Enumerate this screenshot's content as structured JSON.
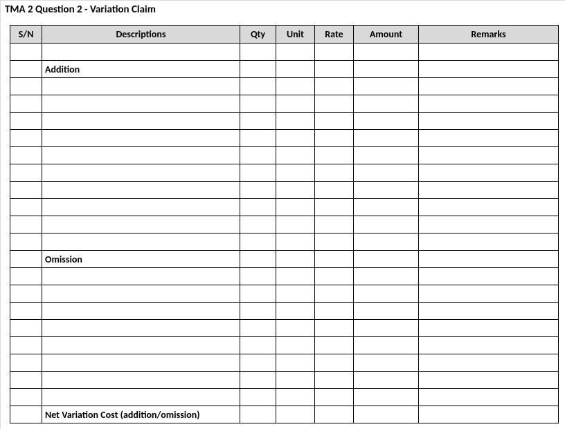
{
  "title": "TMA 2 Question 2 - Variation Claim",
  "headers": {
    "sn": "S/N",
    "desc": "Descriptions",
    "qty": "Qty",
    "unit": "Unit",
    "rate": "Rate",
    "amount": "Amount",
    "remarks": "Remarks"
  },
  "rows": [
    {
      "sn": "",
      "desc": "",
      "qty": "",
      "unit": "",
      "rate": "",
      "amount": "",
      "remarks": "",
      "bold": false
    },
    {
      "sn": "",
      "desc": "Addition",
      "qty": "",
      "unit": "",
      "rate": "",
      "amount": "",
      "remarks": "",
      "bold": true
    },
    {
      "sn": "",
      "desc": "",
      "qty": "",
      "unit": "",
      "rate": "",
      "amount": "",
      "remarks": "",
      "bold": false
    },
    {
      "sn": "",
      "desc": "",
      "qty": "",
      "unit": "",
      "rate": "",
      "amount": "",
      "remarks": "",
      "bold": false
    },
    {
      "sn": "",
      "desc": "",
      "qty": "",
      "unit": "",
      "rate": "",
      "amount": "",
      "remarks": "",
      "bold": false
    },
    {
      "sn": "",
      "desc": "",
      "qty": "",
      "unit": "",
      "rate": "",
      "amount": "",
      "remarks": "",
      "bold": false
    },
    {
      "sn": "",
      "desc": "",
      "qty": "",
      "unit": "",
      "rate": "",
      "amount": "",
      "remarks": "",
      "bold": false
    },
    {
      "sn": "",
      "desc": "",
      "qty": "",
      "unit": "",
      "rate": "",
      "amount": "",
      "remarks": "",
      "bold": false
    },
    {
      "sn": "",
      "desc": "",
      "qty": "",
      "unit": "",
      "rate": "",
      "amount": "",
      "remarks": "",
      "bold": false
    },
    {
      "sn": "",
      "desc": "",
      "qty": "",
      "unit": "",
      "rate": "",
      "amount": "",
      "remarks": "",
      "bold": false
    },
    {
      "sn": "",
      "desc": "",
      "qty": "",
      "unit": "",
      "rate": "",
      "amount": "",
      "remarks": "",
      "bold": false
    },
    {
      "sn": "",
      "desc": "",
      "qty": "",
      "unit": "",
      "rate": "",
      "amount": "",
      "remarks": "",
      "bold": false
    },
    {
      "sn": "",
      "desc": "Omission",
      "qty": "",
      "unit": "",
      "rate": "",
      "amount": "",
      "remarks": "",
      "bold": true
    },
    {
      "sn": "",
      "desc": "",
      "qty": "",
      "unit": "",
      "rate": "",
      "amount": "",
      "remarks": "",
      "bold": false
    },
    {
      "sn": "",
      "desc": "",
      "qty": "",
      "unit": "",
      "rate": "",
      "amount": "",
      "remarks": "",
      "bold": false
    },
    {
      "sn": "",
      "desc": "",
      "qty": "",
      "unit": "",
      "rate": "",
      "amount": "",
      "remarks": "",
      "bold": false
    },
    {
      "sn": "",
      "desc": "",
      "qty": "",
      "unit": "",
      "rate": "",
      "amount": "",
      "remarks": "",
      "bold": false
    },
    {
      "sn": "",
      "desc": "",
      "qty": "",
      "unit": "",
      "rate": "",
      "amount": "",
      "remarks": "",
      "bold": false
    },
    {
      "sn": "",
      "desc": "",
      "qty": "",
      "unit": "",
      "rate": "",
      "amount": "",
      "remarks": "",
      "bold": false
    },
    {
      "sn": "",
      "desc": "",
      "qty": "",
      "unit": "",
      "rate": "",
      "amount": "",
      "remarks": "",
      "bold": false
    },
    {
      "sn": "",
      "desc": "",
      "qty": "",
      "unit": "",
      "rate": "",
      "amount": "",
      "remarks": "",
      "bold": false
    },
    {
      "sn": "",
      "desc": "Net Variation Cost (addition/omission)",
      "qty": "",
      "unit": "",
      "rate": "",
      "amount": "",
      "remarks": "",
      "bold": true
    }
  ]
}
